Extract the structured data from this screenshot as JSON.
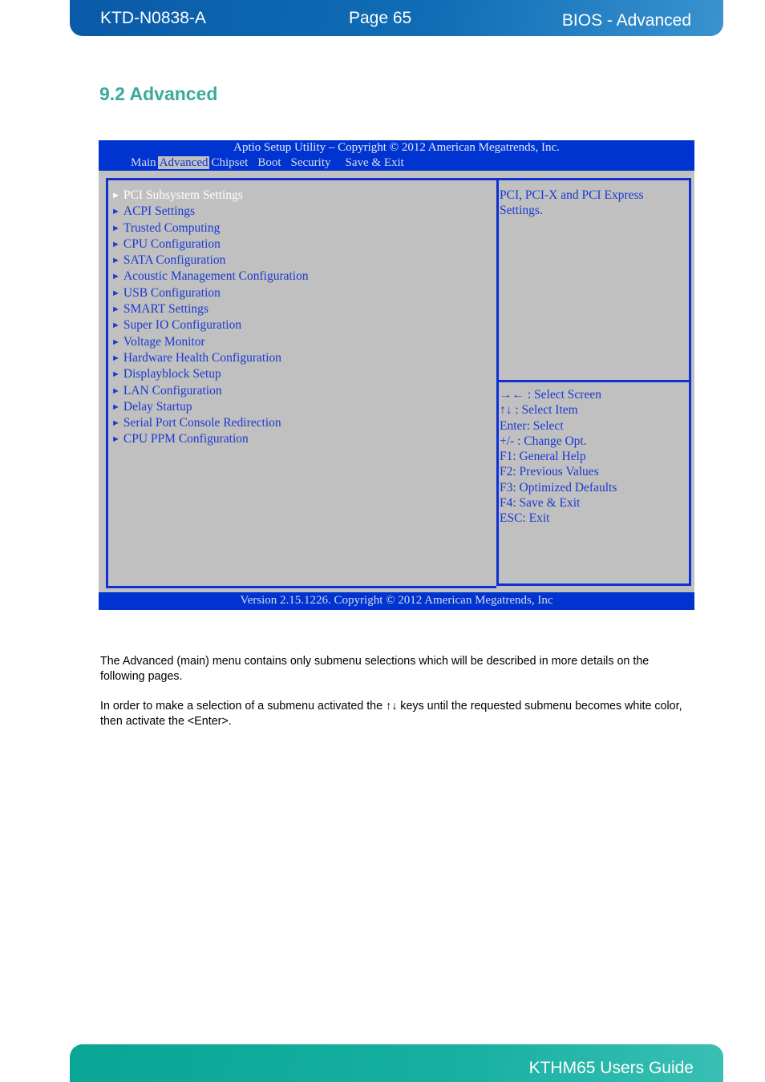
{
  "header": {
    "doc_id": "KTD-N0838-A",
    "page": "Page 65",
    "section": "BIOS - Advanced",
    "color": "#0f6db5"
  },
  "section_title": "9.2  Advanced",
  "bios": {
    "title": "Aptio Setup Utility  –  Copyright © 2012 American Megatrends, Inc.",
    "tabs": [
      {
        "label": "Main",
        "active": false
      },
      {
        "label": "Advanced",
        "active": true
      },
      {
        "label": "Chipset",
        "active": false
      },
      {
        "label": "Boot",
        "active": false
      },
      {
        "label": "Security",
        "active": false
      },
      {
        "label": "Save & Exit",
        "active": false
      }
    ],
    "menu_arrow": "►",
    "menu_items": [
      {
        "label": "PCI Subsystem Settings",
        "selected": true
      },
      {
        "label": "ACPI Settings"
      },
      {
        "label": "Trusted Computing"
      },
      {
        "label": "CPU Configuration"
      },
      {
        "label": "SATA Configuration"
      },
      {
        "label": "Acoustic Management Configuration"
      },
      {
        "label": "USB Configuration"
      },
      {
        "label": "SMART Settings"
      },
      {
        "label": "Super IO Configuration"
      },
      {
        "label": "Voltage Monitor"
      },
      {
        "label": "Hardware Health Configuration"
      },
      {
        "label": "Displayblock Setup"
      },
      {
        "label": "LAN Configuration"
      },
      {
        "label": "Delay Startup"
      },
      {
        "label": "Serial Port Console Redirection"
      },
      {
        "label": "CPU PPM Configuration"
      }
    ],
    "help_text": "PCI, PCI-X and PCI Express Settings.",
    "keys": [
      "→← : Select Screen",
      "↑↓ : Select Item",
      "Enter: Select",
      "+/- : Change Opt.",
      "F1: General Help",
      "F2: Previous Values",
      "F3: Optimized Defaults",
      "F4: Save & Exit",
      "ESC: Exit"
    ],
    "version": "Version 2.15.1226. Copyright © 2012 American Megatrends, Inc",
    "colors": {
      "bar": "#0034d0",
      "panel": "#c0c0c0",
      "text": "#1a3ad0",
      "selected": "#ffffff"
    }
  },
  "body": {
    "paragraph1": "The Advanced (main) menu contains only submenu selections which will be described in more details on the following pages.",
    "paragraph2": "In order to make a selection of a submenu activated the ↑↓ keys until the requested submenu becomes white color, then activate the <Enter>."
  },
  "footer": {
    "title": "KTHM65 Users Guide",
    "color": "#17b0a2"
  }
}
